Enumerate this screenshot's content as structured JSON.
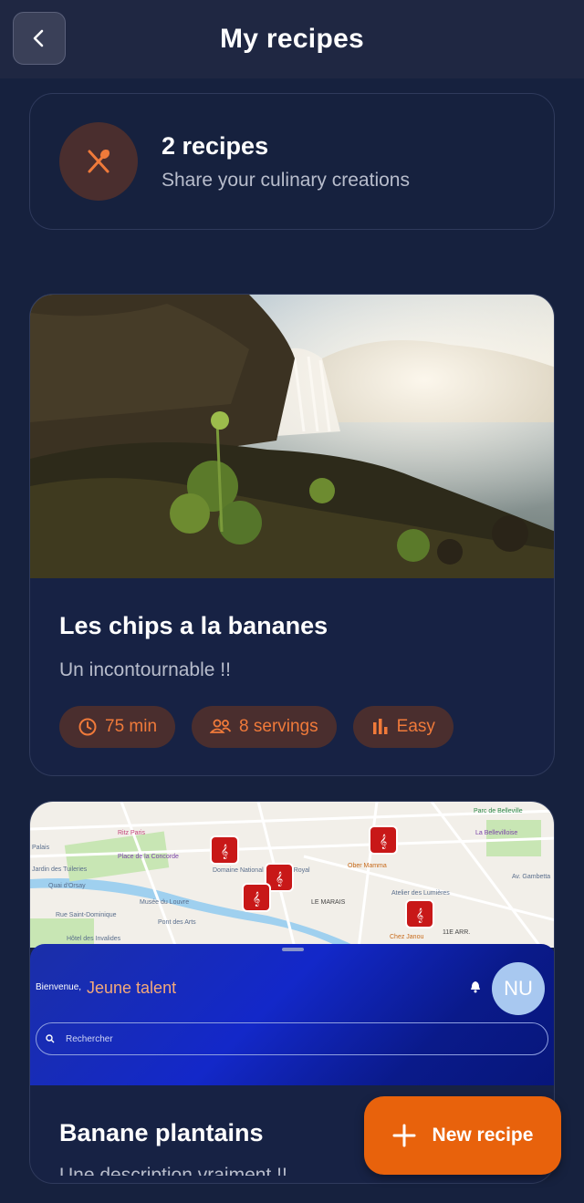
{
  "header": {
    "title": "My recipes",
    "back_icon": "chevron-left-icon"
  },
  "summary": {
    "count": "2 recipes",
    "subtitle": "Share your culinary creations",
    "icon": "utensils-icon",
    "accent": "#f07a3a"
  },
  "recipes": [
    {
      "title": "Les chips a la bananes",
      "description": "Un incontournable !!",
      "time": "75 min",
      "servings": "8 servings",
      "difficulty": "Easy"
    },
    {
      "title": "Banane plantains",
      "description": "Une description vraiment !!",
      "map_labels": [
        "Ritz Paris",
        "Place de la Concorde",
        "Jardin des Tuileries",
        "Domaine National du Palais-Royal",
        "Musée du Louvre",
        "Pont des Arts",
        "Hôtel des Invalides",
        "Rue Saint-Dominique",
        "Quai d'Orsay",
        "LE MARAIS",
        "Ober Mamma",
        "Atelier des Lumières",
        "Chez Janou",
        "11E ARR.",
        "Parc de Belleville",
        "La Bellevilloise",
        "Av. Gambetta",
        "Palais"
      ],
      "overlay": {
        "greeting": "Bienvenue,",
        "name": "Jeune talent",
        "avatar": "NU",
        "search_placeholder": "Rechercher"
      }
    }
  ],
  "fab": {
    "label": "New recipe",
    "icon": "plus-icon"
  },
  "colors": {
    "background": "#16213e",
    "accent": "#e8620c",
    "chip_bg": "#4a2e2e"
  }
}
